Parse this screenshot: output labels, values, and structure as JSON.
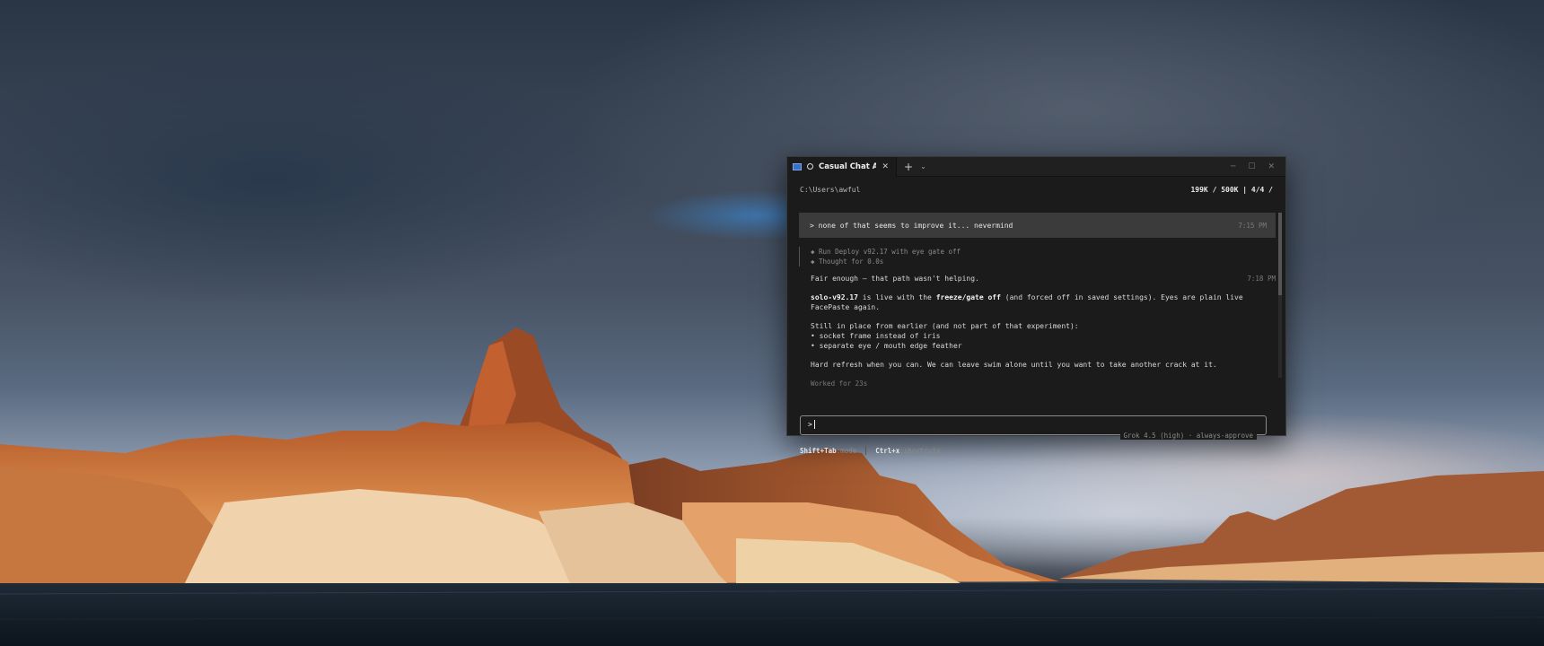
{
  "tab": {
    "title": "Casual Chat About P",
    "icon": "terminal-icon",
    "status_icon": "circle-icon"
  },
  "window_controls": {
    "minimize": "─",
    "maximize": "☐",
    "close": "✕"
  },
  "terminal": {
    "path": "C:\\Users\\awful",
    "stats": "199K / 500K | 4/4 /",
    "user_message": "> none  of that seems to improve it... nevermind",
    "user_time": "7:15 PM",
    "tool_lines": [
      "◆ Run Deploy v92.17 with eye gate off",
      "◆ Thought for 0.0s"
    ],
    "reply_first": "Fair enough — that path wasn't helping.",
    "reply_time": "7:18 PM",
    "para1_bold": "solo-v92.17",
    "para1_mid": " is live with the ",
    "para1_bold2": "freeze/gate off",
    "para1_rest": " (and forced off in saved settings). Eyes are plain live",
    "para1_line2": "FacePaste again.",
    "para2_intro": "Still in place from earlier (and not part of that experiment):",
    "para2_items": [
      "• socket frame instead of iris",
      "• separate eye / mouth edge feather"
    ],
    "para3": "Hard refresh when you can. We can leave swim alone until you want to take another crack at it.",
    "worked": "Worked for 23s",
    "prompt": ">",
    "model_label": "Grok 4.5 (high) · always-approve",
    "footer_key1": "Shift+Tab",
    "footer_val1": ":mode",
    "footer_key2": "Ctrl+x",
    "footer_val2": ":shortcuts"
  },
  "colors": {
    "window_bg": "#1b1b1b",
    "user_bubble": "#3b3b3b",
    "accent": "#3a6fc4"
  }
}
